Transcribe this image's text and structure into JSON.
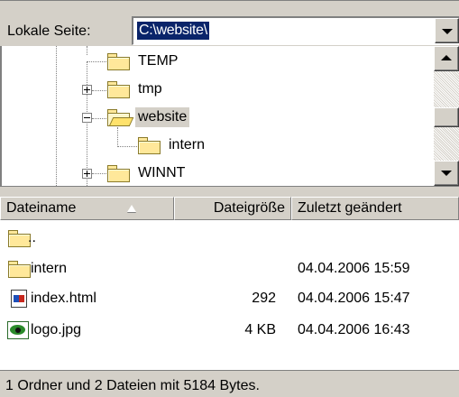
{
  "local_site": {
    "label": "Lokale Seite:",
    "path_value": "C:\\website\\"
  },
  "tree": {
    "items": [
      {
        "label": "TEMP",
        "expander": "none",
        "state": "closed",
        "selected": false
      },
      {
        "label": "tmp",
        "expander": "plus",
        "state": "closed",
        "selected": false
      },
      {
        "label": "website",
        "expander": "minus",
        "state": "open",
        "selected": true
      },
      {
        "label": "intern",
        "expander": "none",
        "state": "closed",
        "selected": false
      },
      {
        "label": "WINNT",
        "expander": "plus",
        "state": "closed",
        "selected": false
      }
    ]
  },
  "file_list": {
    "columns": {
      "name": "Dateiname",
      "size": "Dateigröße",
      "modified": "Zuletzt geändert"
    },
    "sort": {
      "column": "name",
      "direction": "ascending"
    },
    "rows": [
      {
        "icon": "folder-icon",
        "name": "..",
        "size": "",
        "modified": ""
      },
      {
        "icon": "folder-icon",
        "name": "intern",
        "size": "",
        "modified": "04.04.2006 15:59"
      },
      {
        "icon": "html-file-icon",
        "name": "index.html",
        "size": "292",
        "modified": "04.04.2006 15:47"
      },
      {
        "icon": "image-file-icon",
        "name": "logo.jpg",
        "size": "4 KB",
        "modified": "04.04.2006 16:43"
      }
    ]
  },
  "status_bar": {
    "text": "1 Ordner und 2 Dateien mit 5184 Bytes."
  },
  "colors": {
    "window_face": "#d4d0c8",
    "selection_highlight": "#0a246a",
    "folder_yellow": "#ffe89a"
  }
}
